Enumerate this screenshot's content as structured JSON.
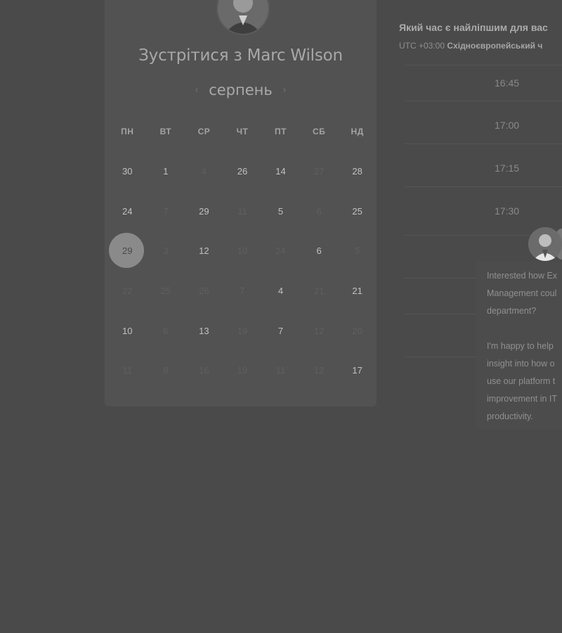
{
  "scheduler": {
    "title": "Зустрітися з Marc Wilson",
    "month": "серпень",
    "prev_icon": "chevron-left-icon",
    "next_icon": "chevron-right-icon",
    "weekdays": [
      "ПН",
      "ВТ",
      "СР",
      "ЧТ",
      "ПТ",
      "СБ",
      "НД"
    ],
    "days": [
      [
        "30",
        "1",
        "4",
        "26",
        "14",
        "27",
        "28"
      ],
      [
        "24",
        "7",
        "29",
        "11",
        "5",
        "6",
        "25"
      ],
      [
        "29",
        "3",
        "12",
        "10",
        "24",
        "6",
        "5"
      ],
      [
        "22",
        "25",
        "26",
        "7",
        "4",
        "21",
        "21"
      ],
      [
        "10",
        "6",
        "13",
        "19",
        "7",
        "12",
        "20"
      ],
      [
        "11",
        "8",
        "16",
        "19",
        "11",
        "12",
        "17"
      ]
    ],
    "selected_day": "29"
  },
  "times": {
    "question": "Який час є найліпшим для вас",
    "tz_offset": "UTC +03:00",
    "tz_name": "Східноєвропейський ч",
    "slots": [
      "16:45",
      "17:00",
      "17:15",
      "17:30"
    ]
  },
  "chat": {
    "lines": [
      "Interested how Ex",
      "Management coul",
      "department?",
      "",
      "I'm happy to help",
      "insight into how o",
      "use our platform t",
      "improvement in IT",
      "productivity."
    ]
  }
}
